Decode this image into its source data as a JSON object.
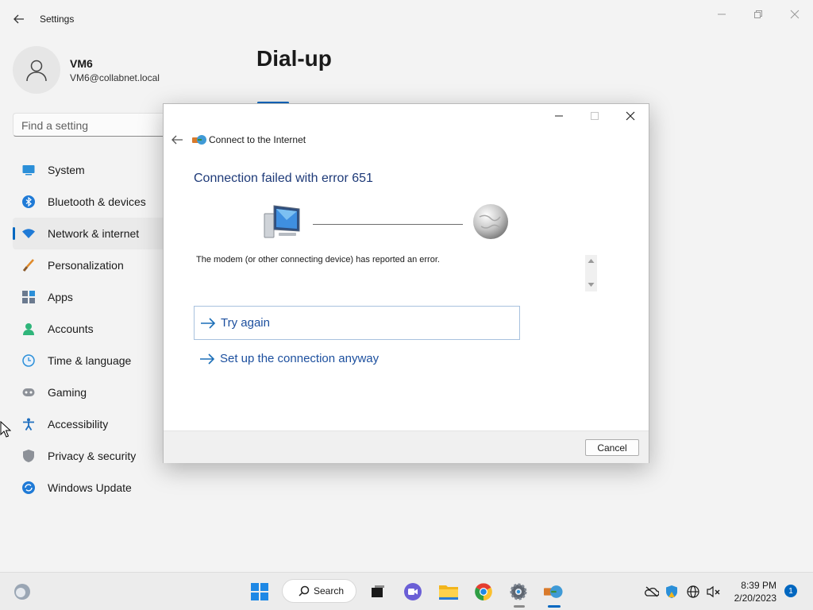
{
  "window": {
    "title": "Settings"
  },
  "user": {
    "name": "VM6",
    "email": "VM6@collabnet.local"
  },
  "search": {
    "placeholder": "Find a setting"
  },
  "sidebar": {
    "items": [
      {
        "label": "System",
        "icon": "system-icon"
      },
      {
        "label": "Bluetooth & devices",
        "icon": "bluetooth-icon"
      },
      {
        "label": "Network & internet",
        "icon": "wifi-icon",
        "selected": true
      },
      {
        "label": "Personalization",
        "icon": "brush-icon"
      },
      {
        "label": "Apps",
        "icon": "apps-icon"
      },
      {
        "label": "Accounts",
        "icon": "person-icon"
      },
      {
        "label": "Time & language",
        "icon": "clock-globe-icon"
      },
      {
        "label": "Gaming",
        "icon": "controller-icon"
      },
      {
        "label": "Accessibility",
        "icon": "accessibility-icon"
      },
      {
        "label": "Privacy & security",
        "icon": "shield-icon"
      },
      {
        "label": "Windows Update",
        "icon": "update-icon"
      }
    ]
  },
  "main": {
    "page_title": "Dial-up"
  },
  "dialog": {
    "title": "Connect to the Internet",
    "heading": "Connection failed with error 651",
    "message": "The modem (or other connecting device) has reported an error.",
    "try_again": "Try again",
    "setup_anyway": "Set up the connection anyway",
    "cancel": "Cancel"
  },
  "taskbar": {
    "search_label": "Search",
    "apps": [
      "start-icon",
      "search-icon",
      "task-view-icon",
      "teams-chat-icon",
      "file-explorer-icon",
      "chrome-icon",
      "settings-icon",
      "connect-to-internet-icon"
    ]
  },
  "tray": {
    "time": "8:39 PM",
    "date": "2/20/2023",
    "notification_count": "1"
  },
  "colors": {
    "accent": "#0067c0",
    "link": "#1c4f9e",
    "heading": "#1e3a78"
  }
}
